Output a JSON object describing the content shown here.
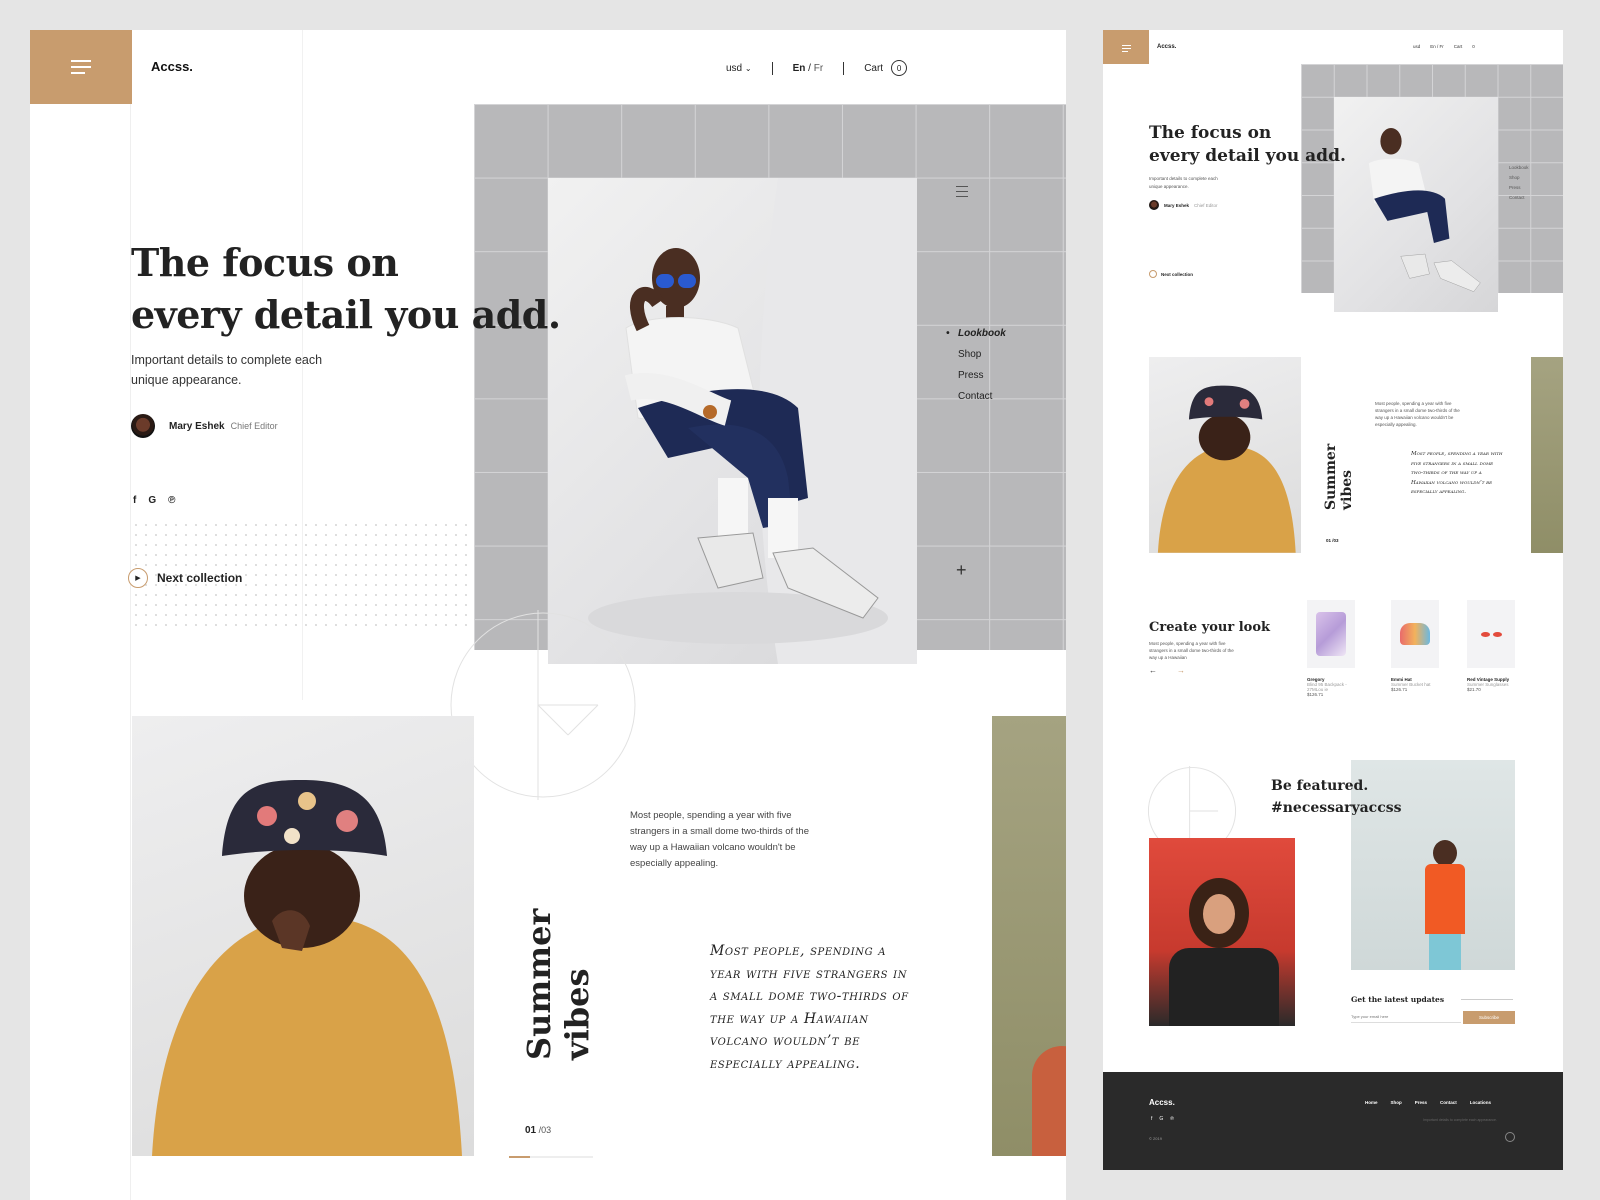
{
  "brand": {
    "logo": "Accss.",
    "accent": "#c89c6e"
  },
  "topnav": {
    "currency": "usd",
    "lang_en": "En",
    "lang_sep": " / ",
    "lang_fr": "Fr",
    "cart_label": "Cart",
    "cart_count": "0"
  },
  "hero": {
    "title_line1": "The focus on",
    "title_line2": "every detail you add.",
    "subtitle_line1": "Important details to complete each",
    "subtitle_line2": "unique appearance.",
    "author_name": "Mary Eshek",
    "author_role": "Chief Editor",
    "social": [
      "f",
      "G",
      "℗"
    ],
    "next_label": "Next collection"
  },
  "sidenav": {
    "items": [
      "Lookbook",
      "Shop",
      "Press",
      "Contact"
    ],
    "active": "Lookbook"
  },
  "summer": {
    "title": "Summer vibes",
    "text_line1": "Most people, spending a year with five",
    "text_line2": "strangers in a small dome two-thirds of the",
    "text_line3": "way up a Hawaiian volcano wouldn't be",
    "text_line4": "especially appealing.",
    "quote_lines": [
      "Most people, spending a",
      "year with five strangers in",
      "a small dome two-thirds of",
      "the way up a Hawaiian",
      "volcano wouldn’t be",
      "especially appealing."
    ],
    "page_current": "01",
    "page_total": " /03"
  },
  "right": {
    "logo": "Accss.",
    "topnav": {
      "currency": "usd",
      "lang": "En / Fr",
      "cart": "Cart",
      "cart_count": "0"
    },
    "hero_title_line1": "The focus on",
    "hero_title_line2": "every detail you add.",
    "hero_sub_line1": "Important details to complete each",
    "hero_sub_line2": "unique appearance.",
    "author_name": "Mary Eshek",
    "author_role": "Chief Editor",
    "next_label": "Next collection",
    "sidenav": [
      "Lookbook",
      "Shop",
      "Press",
      "Contact"
    ],
    "summer_title": "Summer vibes",
    "summer_text": "Most people, spending a year with five strangers in a small dome two-thirds of the way up a Hawaiian volcano wouldn't be especially appealing.",
    "summer_quote": "Most people, spending a year with five strangers in a small dome two-thirds of the way up a Hawaiian volcano wouldn’t be especially appealing.",
    "summer_page": "01 /03",
    "create_title": "Create your look",
    "create_text": "Most people, spending a year with five strangers in a small dome two-thirds of the way up a Hawaiian",
    "products": [
      {
        "name": "Gregory",
        "desc": "Blind 95 Backpack - 27MLou ie",
        "price": "$126.71"
      },
      {
        "name": "Emmi Hat",
        "desc": "Summer Bucket hat",
        "price": "$126.71"
      },
      {
        "name": "Red Vintage Supply",
        "desc": "Summer Sunglasses",
        "price": "$21.70"
      }
    ],
    "featured_line1": "Be featured.",
    "featured_line2": "#necessaryaccss",
    "updates_label": "Get the latest updates",
    "email_placeholder": "Type your email here",
    "subscribe_label": "Subscribe",
    "footer_logo": "Accss.",
    "footer_links": [
      "Home",
      "Shop",
      "Press",
      "Contact",
      "Locations"
    ],
    "footer_tagline": "Important details to complete each appearance.",
    "footer_copy": "© 2019"
  }
}
